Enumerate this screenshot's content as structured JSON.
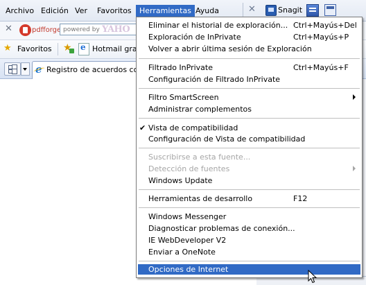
{
  "menubar": {
    "items": [
      "Archivo",
      "Edición",
      "Ver",
      "Favoritos",
      "Herramientas",
      "Ayuda"
    ],
    "snagit": "Snagit"
  },
  "toolbar2": {
    "pdf_label": "pdfforge",
    "search_placeholder": "powered by",
    "yahoo": "YAHO"
  },
  "favorites": {
    "label": "Favoritos",
    "hotmail": "Hotmail gratu"
  },
  "tab": {
    "title": "Registro de acuerdos col..."
  },
  "tools_menu": {
    "groups": [
      [
        {
          "label": "Eliminar el historial de exploración...",
          "shortcut": "Ctrl+Mayús+Del"
        },
        {
          "label": "Exploración de InPrivate",
          "shortcut": "Ctrl+Mayús+P"
        },
        {
          "label": "Volver a abrir última sesión de Exploración",
          "shortcut": ""
        }
      ],
      [
        {
          "label": "Filtrado InPrivate",
          "shortcut": "Ctrl+Mayús+F"
        },
        {
          "label": "Configuración de Filtrado InPrivate",
          "shortcut": ""
        }
      ],
      [
        {
          "label": "Filtro SmartScreen",
          "shortcut": "",
          "submenu": true
        },
        {
          "label": "Administrar complementos",
          "shortcut": ""
        }
      ],
      [
        {
          "label": "Vista de compatibilidad",
          "shortcut": "",
          "checked": true
        },
        {
          "label": "Configuración de Vista de compatibilidad",
          "shortcut": ""
        }
      ],
      [
        {
          "label": "Suscribirse a esta fuente...",
          "shortcut": "",
          "disabled": true
        },
        {
          "label": "Detección de fuentes",
          "shortcut": "",
          "disabled": true,
          "submenu": true
        },
        {
          "label": "Windows Update",
          "shortcut": ""
        }
      ],
      [
        {
          "label": "Herramientas de desarrollo",
          "shortcut": "F12"
        }
      ],
      [
        {
          "label": "Windows Messenger",
          "shortcut": ""
        },
        {
          "label": "Diagnosticar problemas de conexión...",
          "shortcut": ""
        },
        {
          "label": "IE WebDeveloper V2",
          "shortcut": ""
        },
        {
          "label": "Enviar a OneNote",
          "shortcut": ""
        }
      ],
      [
        {
          "label": "Opciones de Internet",
          "shortcut": "",
          "highlighted": true
        }
      ]
    ],
    "check_mark": "✔",
    "highlight_color": "#316ac5"
  }
}
